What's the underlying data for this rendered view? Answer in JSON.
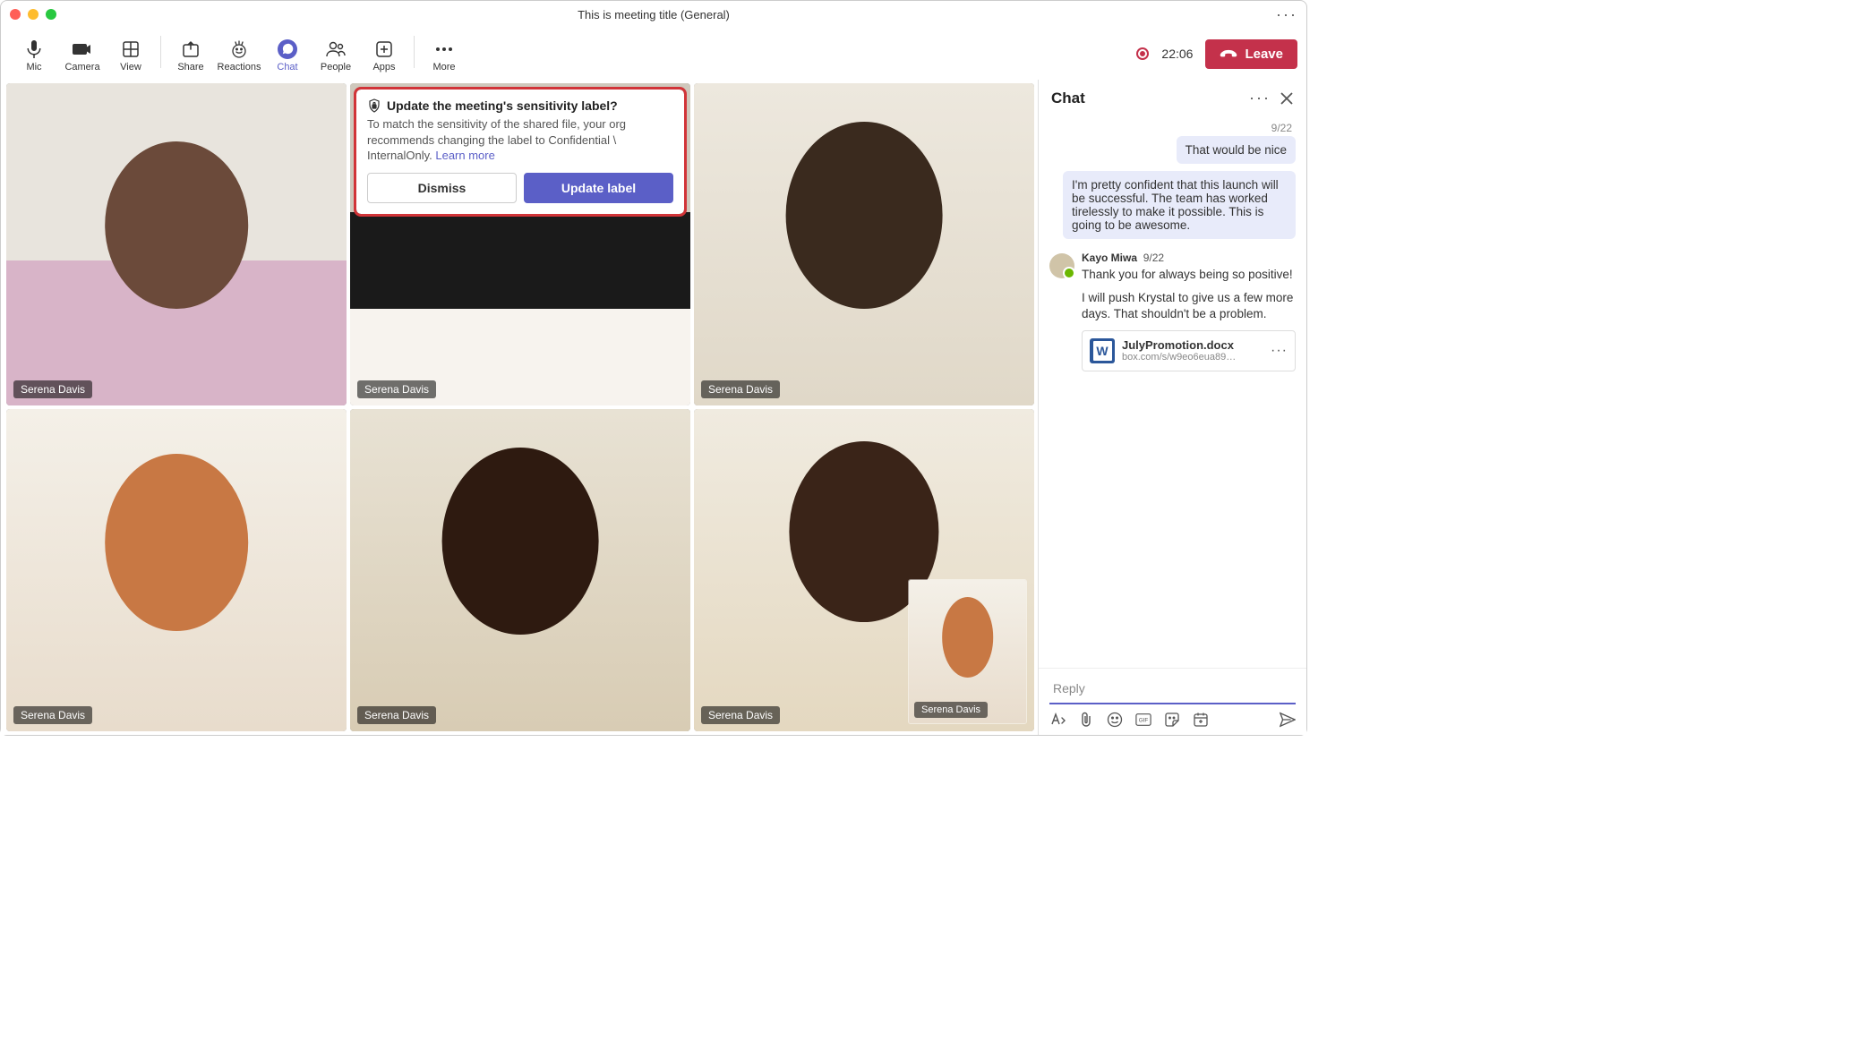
{
  "window": {
    "title": "This is meeting title (General)"
  },
  "toolbar": {
    "mic": "Mic",
    "camera": "Camera",
    "view": "View",
    "share": "Share",
    "reactions": "Reactions",
    "chat": "Chat",
    "people": "People",
    "apps": "Apps",
    "more": "More",
    "timer": "22:06",
    "leave": "Leave"
  },
  "participants": [
    {
      "name": "Serena Davis"
    },
    {
      "name": "Serena Davis"
    },
    {
      "name": "Serena Davis"
    },
    {
      "name": "Serena Davis"
    },
    {
      "name": "Serena Davis"
    },
    {
      "name": "Serena Davis"
    }
  ],
  "selfview_name": "Serena Davis",
  "popup": {
    "title": "Update the meeting's sensitivity label?",
    "body_pre": "To match the sensitivity of the shared file, your org recommends changing the label to Confidential \\ InternalOnly. ",
    "learn_more": "Learn more",
    "dismiss": "Dismiss",
    "update": "Update label"
  },
  "chat": {
    "title": "Chat",
    "threads": {
      "right": {
        "date": "9/22",
        "msg1": "That would be nice",
        "msg2": "I'm pretty confident that this launch will be successful. The team has worked tirelessly to make it possible. This is going to be awesome."
      },
      "left": {
        "author": "Kayo Miwa",
        "date": "9/22",
        "msg1": "Thank you for always being so positive!",
        "msg2": "I will push Krystal to give us a few more days. That shouldn't be a problem.",
        "file": {
          "name": "JulyPromotion.docx",
          "sub": "box.com/s/w9eo6eua89…"
        }
      }
    },
    "reply_placeholder": "Reply"
  }
}
